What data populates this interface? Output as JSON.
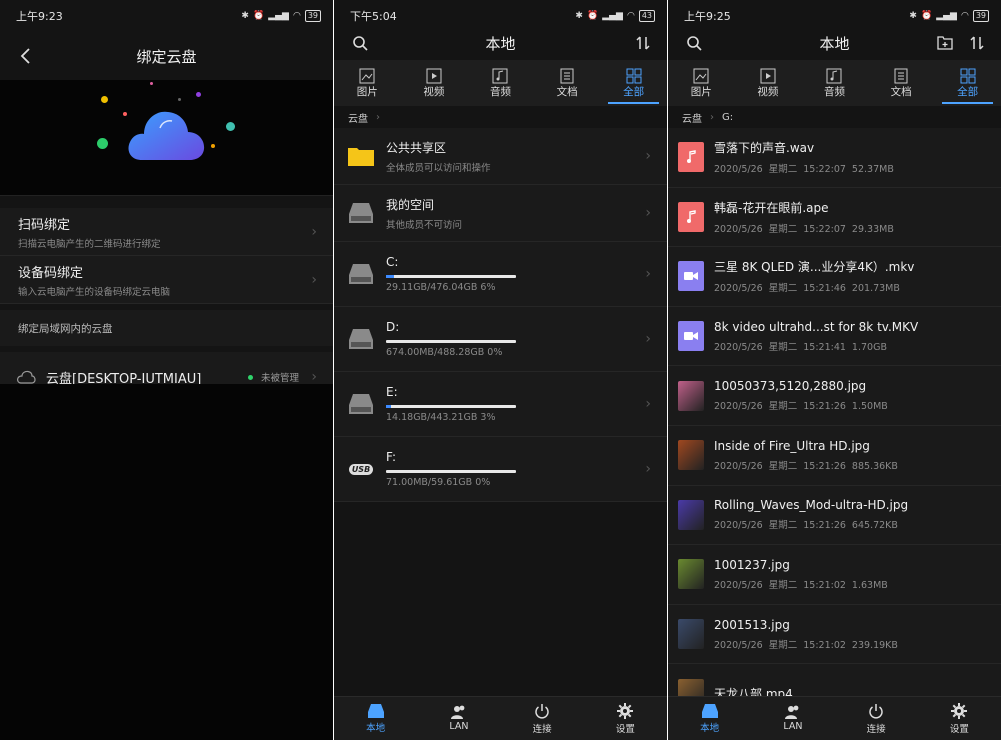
{
  "screen1": {
    "status_time": "上午9:23",
    "battery": "39",
    "title": "绑定云盘",
    "options": [
      {
        "title": "扫码绑定",
        "sub": "扫描云电脑产生的二维码进行绑定"
      },
      {
        "title": "设备码绑定",
        "sub": "输入云电脑产生的设备码绑定云电脑"
      }
    ],
    "section_label": "绑定局域网内的云盘",
    "lan_item": {
      "name": "云盘[DESKTOP-IUTMIAU]",
      "status": "未被管理"
    }
  },
  "screen2": {
    "status_time": "下午5:04",
    "battery": "43",
    "title": "本地",
    "tabs": [
      "图片",
      "视频",
      "音频",
      "文档",
      "全部"
    ],
    "breadcrumb": [
      "云盘"
    ],
    "shares": [
      {
        "title": "公共共享区",
        "sub": "全体成员可以访问和操作"
      },
      {
        "title": "我的空间",
        "sub": "其他成员不可访问"
      }
    ],
    "drives": [
      {
        "name": "C:",
        "info": "29.11GB/476.04GB  6%",
        "fill": 0.06
      },
      {
        "name": "D:",
        "info": "674.00MB/488.28GB  0%",
        "fill": 0.0
      },
      {
        "name": "E:",
        "info": "14.18GB/443.21GB  3%",
        "fill": 0.03
      },
      {
        "name": "F:",
        "info": "71.00MB/59.61GB  0%",
        "fill": 0.0
      }
    ],
    "usb_label": "USB"
  },
  "screen3": {
    "status_time": "上午9:25",
    "battery": "39",
    "title": "本地",
    "tabs": [
      "图片",
      "视频",
      "音频",
      "文档",
      "全部"
    ],
    "breadcrumb": [
      "云盘",
      "G:"
    ],
    "files": [
      {
        "name": "雪落下的声音.wav",
        "meta": "2020/5/26 星期二  15:22:07  52.37MB",
        "kind": "audio"
      },
      {
        "name": "韩磊-花开在眼前.ape",
        "meta": "2020/5/26 星期二  15:22:07  29.33MB",
        "kind": "audio"
      },
      {
        "name": "三星 8K QLED 演...业分享4K）.mkv",
        "meta": "2020/5/26 星期二  15:21:46  201.73MB",
        "kind": "video"
      },
      {
        "name": "8k video ultrahd...st for 8k tv.MKV",
        "meta": "2020/5/26 星期二  15:21:41  1.70GB",
        "kind": "video"
      },
      {
        "name": "10050373,5120,2880.jpg",
        "meta": "2020/5/26 星期二  15:21:26  1.50MB",
        "kind": "image",
        "color": "#c0608a"
      },
      {
        "name": "Inside of Fire_Ultra HD.jpg",
        "meta": "2020/5/26 星期二  15:21:26  885.36KB",
        "kind": "image",
        "color": "#a04820"
      },
      {
        "name": "Rolling_Waves_Mod-ultra-HD.jpg",
        "meta": "2020/5/26 星期二  15:21:26  645.72KB",
        "kind": "image",
        "color": "#4a3aa8"
      },
      {
        "name": "1001237.jpg",
        "meta": "2020/5/26 星期二  15:21:02  1.63MB",
        "kind": "image",
        "color": "#6a8a30"
      },
      {
        "name": "2001513.jpg",
        "meta": "2020/5/26 星期二  15:21:02  239.19KB",
        "kind": "image",
        "color": "#3a4a6a"
      },
      {
        "name": "天龙八部.mp4",
        "meta": "",
        "kind": "image",
        "color": "#8a6030"
      }
    ]
  },
  "bottom_nav": [
    "本地",
    "LAN",
    "连接",
    "设置"
  ],
  "colors": {
    "accent": "#4da3ff",
    "audio": "#f06a6a",
    "video": "#8a7ff0",
    "folder": "#f5c518"
  }
}
